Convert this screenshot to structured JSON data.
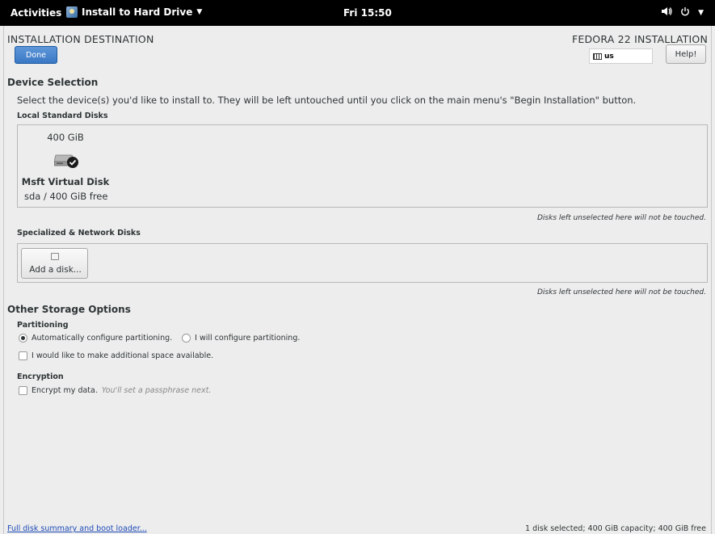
{
  "topbar": {
    "activities": "Activities",
    "app_menu": "Install to Hard Drive",
    "clock": "Fri 15:50",
    "icons": [
      "volume-icon",
      "power-icon",
      "chevron-down-icon"
    ]
  },
  "header": {
    "spoke_title": "INSTALLATION DESTINATION",
    "product_title": "FEDORA 22 INSTALLATION",
    "done_label": "Done",
    "keyboard_layout": "us",
    "help_label": "Help!",
    "accent_color": "#3b78c5"
  },
  "device_selection": {
    "heading": "Device Selection",
    "intro": "Select the device(s) you'd like to install to.  They will be left untouched until you click on the main menu's \"Begin Installation\" button.",
    "local_heading": "Local Standard Disks",
    "disks": [
      {
        "size": "400 GiB",
        "name": "Msft Virtual Disk",
        "detail": "sda / 400 GiB free",
        "selected": true
      }
    ],
    "local_note": "Disks left unselected here will not be touched.",
    "network_heading": "Specialized & Network Disks",
    "add_disk_label": "Add a disk...",
    "network_note": "Disks left unselected here will not be touched."
  },
  "other_storage": {
    "heading": "Other Storage Options",
    "partitioning_heading": "Partitioning",
    "auto_label": "Automatically configure partitioning.",
    "manual_label": "I will configure partitioning.",
    "auto_selected": true,
    "space_label": "I would like to make additional space available.",
    "space_checked": false,
    "encryption_heading": "Encryption",
    "encrypt_label": "Encrypt my data.",
    "encrypt_hint": "You'll set a passphrase next.",
    "encrypt_checked": false
  },
  "footer": {
    "summary_link": "Full disk summary and boot loader...",
    "status": "1 disk selected; 400 GiB capacity; 400 GiB free"
  }
}
